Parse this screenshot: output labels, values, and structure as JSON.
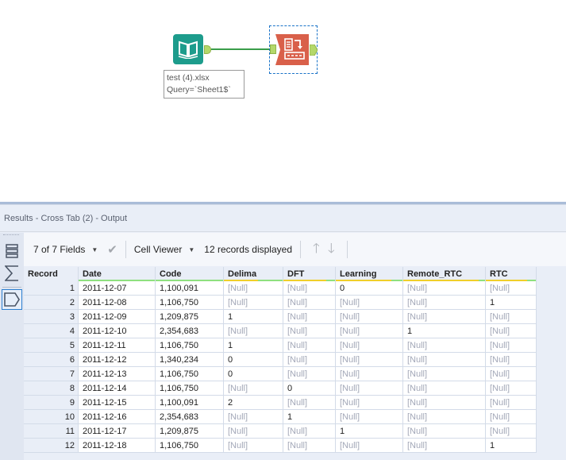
{
  "canvas": {
    "input_tool": {
      "icon": "book-input-icon",
      "color": "#1d9c8c",
      "label_line1": "test (4).xlsx",
      "label_line2": "Query=`Sheet1$`"
    },
    "crosstab_tool": {
      "icon": "cross-tab-icon",
      "color": "#d9604a",
      "selected": true
    },
    "connection_color": "#3a9d4a"
  },
  "results": {
    "title": "Results - Cross Tab (2) - Output",
    "toolbar": {
      "fields_dropdown": "7 of 7 Fields",
      "viewer_dropdown": "Cell Viewer",
      "records_displayed": "12 records displayed"
    },
    "side_rail": [
      "list-view-icon",
      "summary-sigma-icon",
      "tag-output-icon"
    ],
    "columns": [
      "Record",
      "Date",
      "Code",
      "Delima",
      "DFT",
      "Learning",
      "Remote_RTC",
      "RTC"
    ],
    "rows": [
      [
        "1",
        "2011-12-07",
        "1,100,091",
        "[Null]",
        "[Null]",
        "0",
        "[Null]",
        "[Null]"
      ],
      [
        "2",
        "2011-12-08",
        "1,106,750",
        "[Null]",
        "[Null]",
        "[Null]",
        "[Null]",
        "1"
      ],
      [
        "3",
        "2011-12-09",
        "1,209,875",
        "1",
        "[Null]",
        "[Null]",
        "[Null]",
        "[Null]"
      ],
      [
        "4",
        "2011-12-10",
        "2,354,683",
        "[Null]",
        "[Null]",
        "[Null]",
        "1",
        "[Null]"
      ],
      [
        "5",
        "2011-12-11",
        "1,106,750",
        "1",
        "[Null]",
        "[Null]",
        "[Null]",
        "[Null]"
      ],
      [
        "6",
        "2011-12-12",
        "1,340,234",
        "0",
        "[Null]",
        "[Null]",
        "[Null]",
        "[Null]"
      ],
      [
        "7",
        "2011-12-13",
        "1,106,750",
        "0",
        "[Null]",
        "[Null]",
        "[Null]",
        "[Null]"
      ],
      [
        "8",
        "2011-12-14",
        "1,106,750",
        "[Null]",
        "0",
        "[Null]",
        "[Null]",
        "[Null]"
      ],
      [
        "9",
        "2011-12-15",
        "1,100,091",
        "2",
        "[Null]",
        "[Null]",
        "[Null]",
        "[Null]"
      ],
      [
        "10",
        "2011-12-16",
        "2,354,683",
        "[Null]",
        "1",
        "[Null]",
        "[Null]",
        "[Null]"
      ],
      [
        "11",
        "2011-12-17",
        "1,209,875",
        "[Null]",
        "[Null]",
        "1",
        "[Null]",
        "[Null]"
      ],
      [
        "12",
        "2011-12-18",
        "1,106,750",
        "[Null]",
        "[Null]",
        "[Null]",
        "[Null]",
        "1"
      ]
    ],
    "null_percent_by_column": [
      0,
      0,
      0,
      0.58,
      0.83,
      0.83,
      0.92,
      0.83
    ]
  }
}
